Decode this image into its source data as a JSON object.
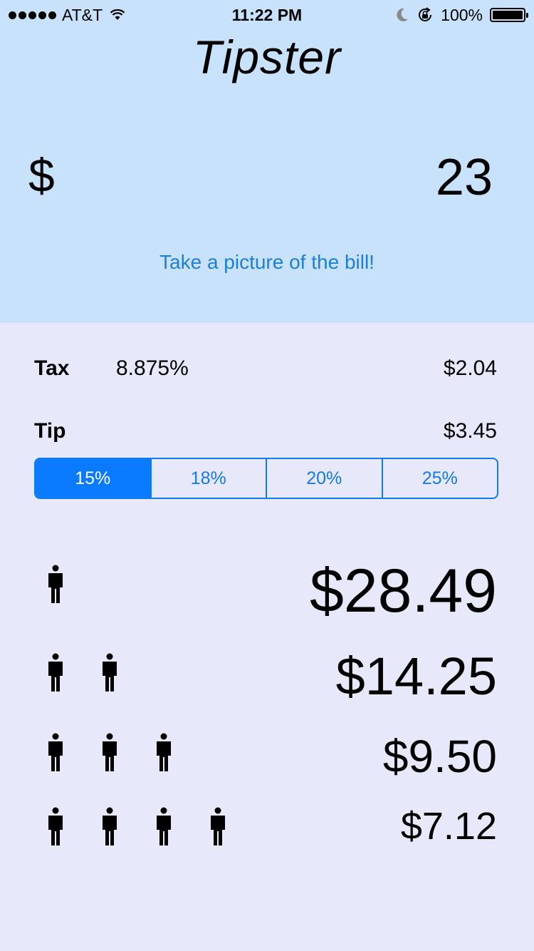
{
  "status_bar": {
    "carrier": "AT&T",
    "time": "11:22 PM",
    "battery": "100%"
  },
  "app": {
    "title": "Tipster"
  },
  "bill": {
    "currency_symbol": "$",
    "value": "23",
    "picture_link": "Take a picture of the bill!"
  },
  "tax": {
    "label": "Tax",
    "rate": "8.875%",
    "amount": "$2.04"
  },
  "tip": {
    "label": "Tip",
    "amount": "$3.45",
    "options": [
      "15%",
      "18%",
      "20%",
      "25%"
    ],
    "selected_index": 0
  },
  "split": [
    {
      "people": 1,
      "amount": "$28.49"
    },
    {
      "people": 2,
      "amount": "$14.25"
    },
    {
      "people": 3,
      "amount": "$9.50"
    },
    {
      "people": 4,
      "amount": "$7.12"
    }
  ],
  "colors": {
    "top_bg": "#c8e2fb",
    "bottom_bg": "#e8e8fb",
    "accent": "#0a7aff",
    "link": "#1d7fd6"
  },
  "icons": [
    "wifi-icon",
    "moon-icon",
    "rotation-lock-icon",
    "battery-icon",
    "person-icon"
  ]
}
